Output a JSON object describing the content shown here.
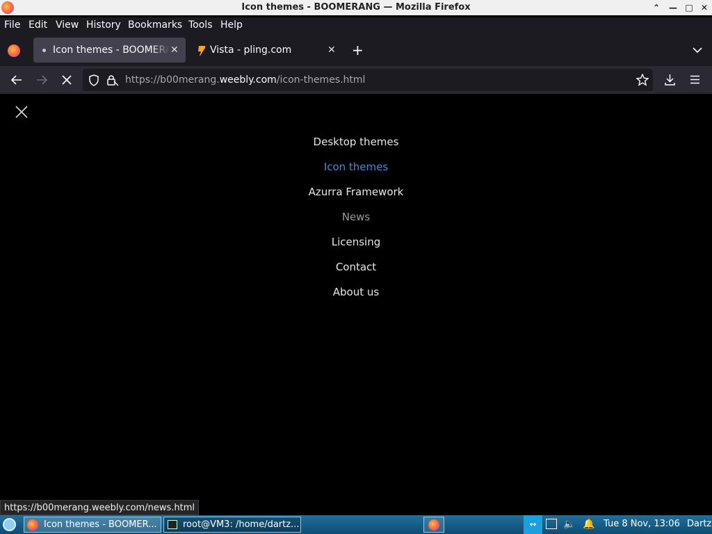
{
  "window": {
    "title": "Icon themes - BOOMERANG — Mozilla Firefox"
  },
  "menu": [
    "File",
    "Edit",
    "View",
    "History",
    "Bookmarks",
    "Tools",
    "Help"
  ],
  "tabs": [
    {
      "label": "Icon themes - BOOMERANG",
      "active": true
    },
    {
      "label": "Vista - pling.com",
      "active": false
    }
  ],
  "url": {
    "prefix": "https://b00merang.",
    "domain": "weebly.com",
    "path": "/icon-themes.html"
  },
  "site_nav": {
    "items": [
      {
        "label": "Desktop themes",
        "state": "normal"
      },
      {
        "label": "Icon themes",
        "state": "active"
      },
      {
        "label": "Azurra Framework",
        "state": "normal"
      },
      {
        "label": "News",
        "state": "hover"
      },
      {
        "label": "Licensing",
        "state": "normal"
      },
      {
        "label": "Contact",
        "state": "normal"
      },
      {
        "label": "About us",
        "state": "normal"
      }
    ]
  },
  "status_url": "https://b00merang.weebly.com/news.html",
  "taskbar": {
    "tasks": [
      "Icon themes - BOOMER...",
      "root@VM3: /home/dartz..."
    ],
    "clock": "Tue  8 Nov, 13:06",
    "user": "Dartz"
  },
  "colors": {
    "accent_link": "#3d8fd6",
    "toolbar_bg": "#2b2a33",
    "taskbar": "#1f6f9c"
  }
}
